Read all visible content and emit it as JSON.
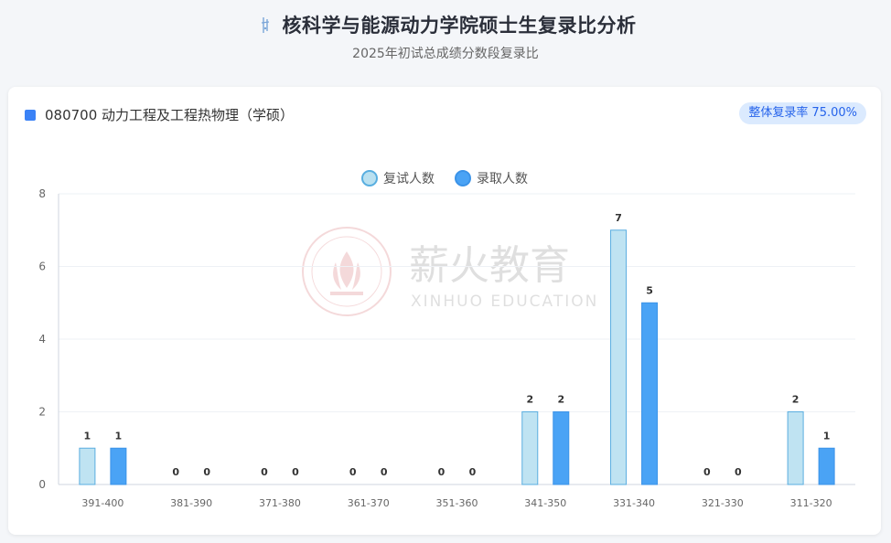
{
  "header": {
    "title": "核科学与能源动力学院硕士生复录比分析",
    "subtitle": "2025年初试总成绩分数段复录比"
  },
  "card": {
    "program": "080700 动力工程及工程热物理（学硕）",
    "rate_label": "整体复录率",
    "rate_value": "75.00%"
  },
  "watermark": {
    "cn": "薪火教育",
    "en": "XINHUO EDUCATION",
    "seal_cn": "薪火教育",
    "seal_en": "XINHUO EDUCATION"
  },
  "colors": {
    "interview_fill": "#bfe3f2",
    "interview_stroke": "#5aaee0",
    "admit_fill": "#4aa3f5",
    "admit_stroke": "#3b93e8",
    "accent": "#3b82f6"
  },
  "chart_data": {
    "type": "bar",
    "categories": [
      "391-400",
      "381-390",
      "371-380",
      "361-370",
      "351-360",
      "341-350",
      "331-340",
      "321-330",
      "311-320"
    ],
    "series": [
      {
        "name": "复试人数",
        "values": [
          1,
          0,
          0,
          0,
          0,
          2,
          7,
          0,
          2
        ]
      },
      {
        "name": "录取人数",
        "values": [
          1,
          0,
          0,
          0,
          0,
          2,
          5,
          0,
          1
        ]
      }
    ],
    "ylim": [
      0,
      8
    ],
    "yticks": [
      0,
      2,
      4,
      6,
      8
    ],
    "grid": true,
    "legend_position": "top-center"
  }
}
